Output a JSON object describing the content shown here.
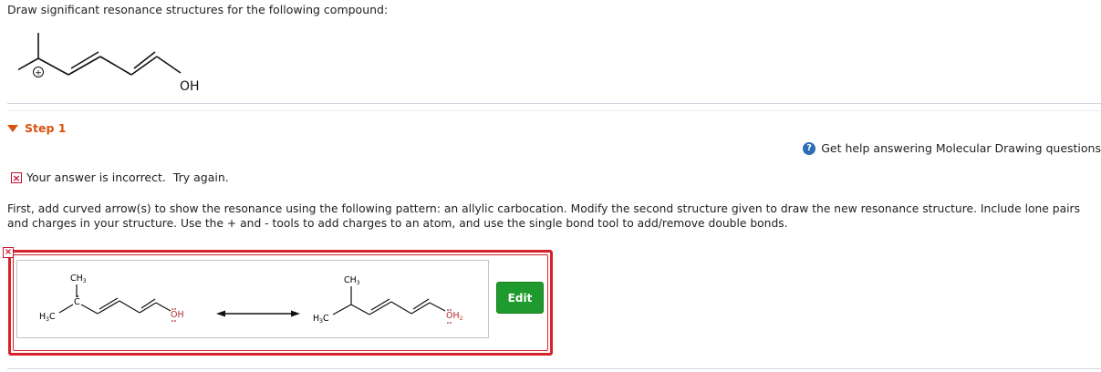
{
  "question": {
    "prompt": "Draw significant resonance structures for the following compound:"
  },
  "compound": {
    "charge": "+",
    "oh_label": "OH"
  },
  "step": {
    "label": "Step 1"
  },
  "help": {
    "icon": "question-icon",
    "text": "Get help answering Molecular Drawing questions"
  },
  "feedback": {
    "icon": "x-icon",
    "text": "Your answer is incorrect.  Try again."
  },
  "instructions": "First, add curved arrow(s) to show the resonance using the following pattern: an allylic carbocation. Modify the second structure given to draw the new resonance structure. Include lone pairs and charges in your structure. Use the + and - tools to add charges to an atom, and use the single bond tool to add/remove double bonds.",
  "answer": {
    "structure1": {
      "ch3_top": "CH",
      "ch3_top_sub": "3",
      "h3c": "H",
      "h3c_sub": "3",
      "h3c_c": "C",
      "center_c": "C",
      "oh": "OH"
    },
    "structure2": {
      "ch3_top": "CH",
      "ch3_top_sub": "3",
      "h3c": "H",
      "h3c_sub": "3",
      "h3c_c": "C",
      "oh": "OH",
      "oh_sub": "2"
    },
    "edit_label": "Edit",
    "colors": {
      "error": "#d8232a",
      "edit_button": "#1f9a2e",
      "step": "#d9530f"
    }
  }
}
